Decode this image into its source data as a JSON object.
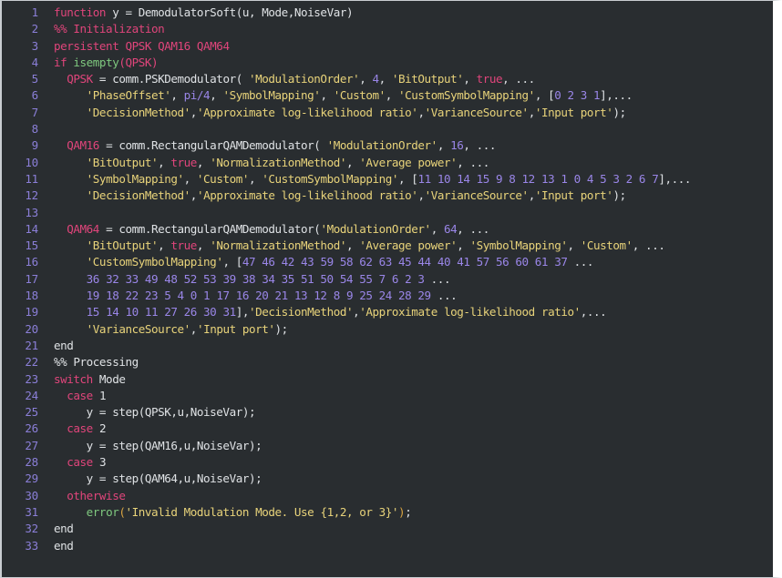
{
  "editor": {
    "name": "matlab-code-editor",
    "language": "MATLAB",
    "theme": "dark",
    "background_color": "#292d30",
    "gutter_color": "#292d30",
    "line_number_color": "#8b7fd8",
    "default_text_color": "#d7dadd",
    "string_color": "#e8d37a",
    "keyword_color": "#e0457b",
    "number_color": "#9a86e8",
    "function_color": "#7fc97f",
    "bracket_color": "#d9a441",
    "total_lines": 33,
    "first_line_number": 1
  },
  "lines": [
    {
      "number": "1",
      "text": "function y = DemodulatorSoft(u, Mode,NoiseVar)",
      "tokens": [
        {
          "t": "function",
          "c": "t-kw"
        },
        {
          "t": " y = ",
          "c": "t-plain"
        },
        {
          "t": "DemodulatorSoft",
          "c": "t-plain"
        },
        {
          "t": "(u, Mode,NoiseVar)",
          "c": "t-plain"
        }
      ]
    },
    {
      "number": "2",
      "text": "%% Initialization",
      "tokens": [
        {
          "t": "%% Initialization",
          "c": "t-comment"
        }
      ]
    },
    {
      "number": "3",
      "text": "persistent QPSK QAM16 QAM64",
      "tokens": [
        {
          "t": "persistent",
          "c": "t-kw"
        },
        {
          "t": " QPSK QAM16 QAM64",
          "c": "t-kw"
        }
      ]
    },
    {
      "number": "4",
      "text": "if isempty(QPSK)",
      "tokens": [
        {
          "t": "if ",
          "c": "t-kw"
        },
        {
          "t": "isempty",
          "c": "t-fn"
        },
        {
          "t": "(QPSK)",
          "c": "t-kw"
        }
      ]
    },
    {
      "number": "5",
      "text": "  QPSK = comm.PSKDemodulator( 'ModulationOrder', 4, 'BitOutput', true, ...",
      "tokens": [
        {
          "t": "  ",
          "c": "t-plain"
        },
        {
          "t": "QPSK",
          "c": "t-kw"
        },
        {
          "t": " = comm.PSKDemodulator( ",
          "c": "t-plain"
        },
        {
          "t": "'ModulationOrder'",
          "c": "t-str"
        },
        {
          "t": ", ",
          "c": "t-plain"
        },
        {
          "t": "4",
          "c": "t-num"
        },
        {
          "t": ", ",
          "c": "t-plain"
        },
        {
          "t": "'BitOutput'",
          "c": "t-str"
        },
        {
          "t": ", ",
          "c": "t-plain"
        },
        {
          "t": "true",
          "c": "t-kw"
        },
        {
          "t": ", ...",
          "c": "t-plain"
        }
      ]
    },
    {
      "number": "6",
      "text": "     'PhaseOffset', pi/4, 'SymbolMapping', 'Custom', 'CustomSymbolMapping', [0 2 3 1],...",
      "tokens": [
        {
          "t": "     ",
          "c": "t-plain"
        },
        {
          "t": "'PhaseOffset'",
          "c": "t-str"
        },
        {
          "t": ", ",
          "c": "t-plain"
        },
        {
          "t": "pi/4",
          "c": "t-num"
        },
        {
          "t": ", ",
          "c": "t-plain"
        },
        {
          "t": "'SymbolMapping'",
          "c": "t-str"
        },
        {
          "t": ", ",
          "c": "t-plain"
        },
        {
          "t": "'Custom'",
          "c": "t-str"
        },
        {
          "t": ", ",
          "c": "t-plain"
        },
        {
          "t": "'CustomSymbolMapping'",
          "c": "t-str"
        },
        {
          "t": ", [",
          "c": "t-plain"
        },
        {
          "t": "0 2 3 1",
          "c": "t-num"
        },
        {
          "t": "],...",
          "c": "t-plain"
        }
      ]
    },
    {
      "number": "7",
      "text": "     'DecisionMethod','Approximate log-likelihood ratio','VarianceSource','Input port');",
      "tokens": [
        {
          "t": "     ",
          "c": "t-plain"
        },
        {
          "t": "'DecisionMethod'",
          "c": "t-str"
        },
        {
          "t": ",",
          "c": "t-plain"
        },
        {
          "t": "'Approximate log-likelihood ratio'",
          "c": "t-str"
        },
        {
          "t": ",",
          "c": "t-plain"
        },
        {
          "t": "'VarianceSource'",
          "c": "t-str"
        },
        {
          "t": ",",
          "c": "t-plain"
        },
        {
          "t": "'Input port'",
          "c": "t-str"
        },
        {
          "t": ");",
          "c": "t-plain"
        }
      ]
    },
    {
      "number": "8",
      "text": "",
      "tokens": []
    },
    {
      "number": "9",
      "text": "  QAM16 = comm.RectangularQAMDemodulator( 'ModulationOrder', 16, ...",
      "tokens": [
        {
          "t": "  ",
          "c": "t-plain"
        },
        {
          "t": "QAM16",
          "c": "t-kw"
        },
        {
          "t": " = comm.RectangularQAMDemodulator( ",
          "c": "t-plain"
        },
        {
          "t": "'ModulationOrder'",
          "c": "t-str"
        },
        {
          "t": ", ",
          "c": "t-plain"
        },
        {
          "t": "16",
          "c": "t-num"
        },
        {
          "t": ", ...",
          "c": "t-plain"
        }
      ]
    },
    {
      "number": "10",
      "text": "     'BitOutput', true, 'NormalizationMethod', 'Average power', ...",
      "tokens": [
        {
          "t": "     ",
          "c": "t-plain"
        },
        {
          "t": "'BitOutput'",
          "c": "t-str"
        },
        {
          "t": ", ",
          "c": "t-plain"
        },
        {
          "t": "true",
          "c": "t-kw"
        },
        {
          "t": ", ",
          "c": "t-plain"
        },
        {
          "t": "'NormalizationMethod'",
          "c": "t-str"
        },
        {
          "t": ", ",
          "c": "t-plain"
        },
        {
          "t": "'Average power'",
          "c": "t-str"
        },
        {
          "t": ", ...",
          "c": "t-plain"
        }
      ]
    },
    {
      "number": "11",
      "text": "     'SymbolMapping', 'Custom', 'CustomSymbolMapping', [11 10 14 15 9 8 12 13 1 0 4 5 3 2 6 7],...",
      "tokens": [
        {
          "t": "     ",
          "c": "t-plain"
        },
        {
          "t": "'SymbolMapping'",
          "c": "t-str"
        },
        {
          "t": ", ",
          "c": "t-plain"
        },
        {
          "t": "'Custom'",
          "c": "t-str"
        },
        {
          "t": ", ",
          "c": "t-plain"
        },
        {
          "t": "'CustomSymbolMapping'",
          "c": "t-str"
        },
        {
          "t": ", [",
          "c": "t-plain"
        },
        {
          "t": "11 10 14 15 9 8 12 13 1 0 4 5 3 2 6 7",
          "c": "t-num"
        },
        {
          "t": "],...",
          "c": "t-plain"
        }
      ]
    },
    {
      "number": "12",
      "text": "     'DecisionMethod','Approximate log-likelihood ratio','VarianceSource','Input port');",
      "tokens": [
        {
          "t": "     ",
          "c": "t-plain"
        },
        {
          "t": "'DecisionMethod'",
          "c": "t-str"
        },
        {
          "t": ",",
          "c": "t-plain"
        },
        {
          "t": "'Approximate log-likelihood ratio'",
          "c": "t-str"
        },
        {
          "t": ",",
          "c": "t-plain"
        },
        {
          "t": "'VarianceSource'",
          "c": "t-str"
        },
        {
          "t": ",",
          "c": "t-plain"
        },
        {
          "t": "'Input port'",
          "c": "t-str"
        },
        {
          "t": ");",
          "c": "t-plain"
        }
      ]
    },
    {
      "number": "13",
      "text": "",
      "tokens": []
    },
    {
      "number": "14",
      "text": "  QAM64 = comm.RectangularQAMDemodulator('ModulationOrder', 64, ...",
      "tokens": [
        {
          "t": "  ",
          "c": "t-plain"
        },
        {
          "t": "QAM64",
          "c": "t-kw"
        },
        {
          "t": " = comm.RectangularQAMDemodulator(",
          "c": "t-plain"
        },
        {
          "t": "'ModulationOrder'",
          "c": "t-str"
        },
        {
          "t": ", ",
          "c": "t-plain"
        },
        {
          "t": "64",
          "c": "t-num"
        },
        {
          "t": ", ...",
          "c": "t-plain"
        }
      ]
    },
    {
      "number": "15",
      "text": "     'BitOutput', true, 'NormalizationMethod', 'Average power', 'SymbolMapping', 'Custom', ...",
      "tokens": [
        {
          "t": "     ",
          "c": "t-plain"
        },
        {
          "t": "'BitOutput'",
          "c": "t-str"
        },
        {
          "t": ", ",
          "c": "t-plain"
        },
        {
          "t": "true",
          "c": "t-kw"
        },
        {
          "t": ", ",
          "c": "t-plain"
        },
        {
          "t": "'NormalizationMethod'",
          "c": "t-str"
        },
        {
          "t": ", ",
          "c": "t-plain"
        },
        {
          "t": "'Average power'",
          "c": "t-str"
        },
        {
          "t": ", ",
          "c": "t-plain"
        },
        {
          "t": "'SymbolMapping'",
          "c": "t-str"
        },
        {
          "t": ", ",
          "c": "t-plain"
        },
        {
          "t": "'Custom'",
          "c": "t-str"
        },
        {
          "t": ", ...",
          "c": "t-plain"
        }
      ]
    },
    {
      "number": "16",
      "text": "     'CustomSymbolMapping', [47 46 42 43 59 58 62 63 45 44 40 41 57 56 60 61 37 ...",
      "tokens": [
        {
          "t": "     ",
          "c": "t-plain"
        },
        {
          "t": "'CustomSymbolMapping'",
          "c": "t-str"
        },
        {
          "t": ", [",
          "c": "t-plain"
        },
        {
          "t": "47 46 42 43 59 58 62 63 45 44 40 41 57 56 60 61 37",
          "c": "t-num"
        },
        {
          "t": " ...",
          "c": "t-plain"
        }
      ]
    },
    {
      "number": "17",
      "text": "     36 32 33 49 48 52 53 39 38 34 35 51 50 54 55 7 6 2 3 ...",
      "tokens": [
        {
          "t": "     ",
          "c": "t-plain"
        },
        {
          "t": "36 32 33 49 48 52 53 39 38 34 35 51 50 54 55 7 6 2 3",
          "c": "t-num"
        },
        {
          "t": " ...",
          "c": "t-plain"
        }
      ]
    },
    {
      "number": "18",
      "text": "     19 18 22 23 5 4 0 1 17 16 20 21 13 12 8 9 25 24 28 29 ...",
      "tokens": [
        {
          "t": "     ",
          "c": "t-plain"
        },
        {
          "t": "19 18 22 23 5 4 0 1 17 16 20 21 13 12 8 9 25 24 28 29",
          "c": "t-num"
        },
        {
          "t": " ...",
          "c": "t-plain"
        }
      ]
    },
    {
      "number": "19",
      "text": "     15 14 10 11 27 26 30 31],'DecisionMethod','Approximate log-likelihood ratio',...",
      "tokens": [
        {
          "t": "     ",
          "c": "t-plain"
        },
        {
          "t": "15 14 10 11 27 26 30 31",
          "c": "t-num"
        },
        {
          "t": "],",
          "c": "t-plain"
        },
        {
          "t": "'DecisionMethod'",
          "c": "t-str"
        },
        {
          "t": ",",
          "c": "t-plain"
        },
        {
          "t": "'Approximate log-likelihood ratio'",
          "c": "t-str"
        },
        {
          "t": ",...",
          "c": "t-plain"
        }
      ]
    },
    {
      "number": "20",
      "text": "     'VarianceSource','Input port');",
      "tokens": [
        {
          "t": "     ",
          "c": "t-plain"
        },
        {
          "t": "'VarianceSource'",
          "c": "t-str"
        },
        {
          "t": ",",
          "c": "t-plain"
        },
        {
          "t": "'Input port'",
          "c": "t-str"
        },
        {
          "t": ");",
          "c": "t-plain"
        }
      ]
    },
    {
      "number": "21",
      "text": "end",
      "tokens": [
        {
          "t": "end",
          "c": "t-plain"
        }
      ]
    },
    {
      "number": "22",
      "text": "%% Processing",
      "tokens": [
        {
          "t": "%% Processing",
          "c": "t-plain"
        }
      ]
    },
    {
      "number": "23",
      "text": "switch Mode",
      "tokens": [
        {
          "t": "switch",
          "c": "t-kw"
        },
        {
          "t": " Mode",
          "c": "t-plain"
        }
      ]
    },
    {
      "number": "24",
      "text": "  case 1",
      "tokens": [
        {
          "t": "  ",
          "c": "t-plain"
        },
        {
          "t": "case",
          "c": "t-case"
        },
        {
          "t": " ",
          "c": "t-plain"
        },
        {
          "t": "1",
          "c": "t-plain"
        }
      ]
    },
    {
      "number": "25",
      "text": "     y = step(QPSK,u,NoiseVar);",
      "tokens": [
        {
          "t": "     y = step(QPSK,u,NoiseVar);",
          "c": "t-plain"
        }
      ]
    },
    {
      "number": "26",
      "text": "  case 2",
      "tokens": [
        {
          "t": "  ",
          "c": "t-plain"
        },
        {
          "t": "case",
          "c": "t-case"
        },
        {
          "t": " ",
          "c": "t-plain"
        },
        {
          "t": "2",
          "c": "t-plain"
        }
      ]
    },
    {
      "number": "27",
      "text": "     y = step(QAM16,u,NoiseVar);",
      "tokens": [
        {
          "t": "     y = step(QAM16,u,NoiseVar);",
          "c": "t-plain"
        }
      ]
    },
    {
      "number": "28",
      "text": "  case 3",
      "tokens": [
        {
          "t": "  ",
          "c": "t-plain"
        },
        {
          "t": "case",
          "c": "t-case"
        },
        {
          "t": " ",
          "c": "t-plain"
        },
        {
          "t": "3",
          "c": "t-plain"
        }
      ]
    },
    {
      "number": "29",
      "text": "     y = step(QAM64,u,NoiseVar);",
      "tokens": [
        {
          "t": "     y = step(QAM64,u,NoiseVar);",
          "c": "t-plain"
        }
      ]
    },
    {
      "number": "30",
      "text": "  otherwise",
      "tokens": [
        {
          "t": "  ",
          "c": "t-plain"
        },
        {
          "t": "otherwise",
          "c": "t-case"
        }
      ]
    },
    {
      "number": "31",
      "text": "     error('Invalid Modulation Mode. Use {1,2, or 3}');",
      "tokens": [
        {
          "t": "     ",
          "c": "t-plain"
        },
        {
          "t": "error",
          "c": "t-fn"
        },
        {
          "t": "(",
          "c": "t-bracket"
        },
        {
          "t": "'Invalid Modulation Mode. Use {1,2, or 3}'",
          "c": "t-str"
        },
        {
          "t": ")",
          "c": "t-bracket"
        },
        {
          "t": ";",
          "c": "t-plain"
        }
      ]
    },
    {
      "number": "32",
      "text": "end",
      "tokens": [
        {
          "t": "end",
          "c": "t-plain"
        }
      ]
    },
    {
      "number": "33",
      "text": "end",
      "tokens": [
        {
          "t": "end",
          "c": "t-plain"
        }
      ]
    }
  ]
}
